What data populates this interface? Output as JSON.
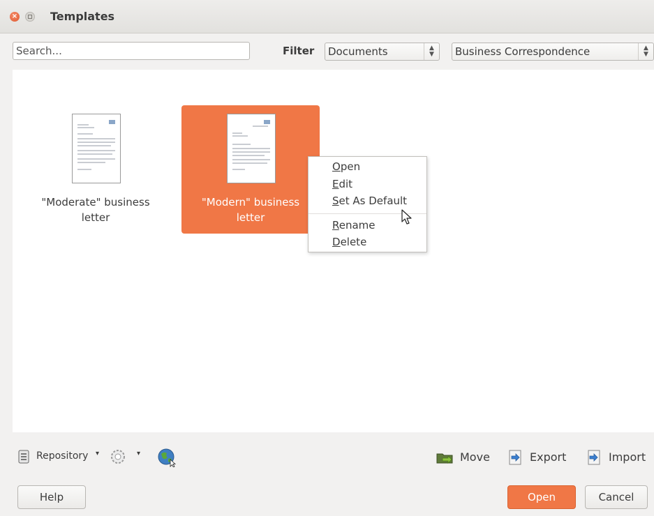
{
  "window": {
    "title": "Templates"
  },
  "search": {
    "placeholder": "Search..."
  },
  "filter": {
    "label": "Filter",
    "document_type": "Documents",
    "category": "Business Correspondence"
  },
  "templates": [
    {
      "line1": "\"Moderate\" business",
      "line2": "letter",
      "selected": false
    },
    {
      "line1": "\"Modern\" business",
      "line2": "letter",
      "selected": true
    }
  ],
  "context_menu": {
    "items": [
      {
        "mnemonic": "O",
        "rest": "pen"
      },
      {
        "mnemonic": "E",
        "rest": "dit"
      },
      {
        "mnemonic": "S",
        "rest": "et As Default"
      },
      {
        "mnemonic": "R",
        "rest": "ename"
      },
      {
        "mnemonic": "D",
        "rest": "elete"
      }
    ]
  },
  "toolbar": {
    "repository": "Repository",
    "move": "Move",
    "export": "Export",
    "import": "Import"
  },
  "buttons": {
    "help": "Help",
    "open": "Open",
    "cancel": "Cancel"
  },
  "colors": {
    "accent": "#f07746",
    "background": "#f2f1f0"
  }
}
